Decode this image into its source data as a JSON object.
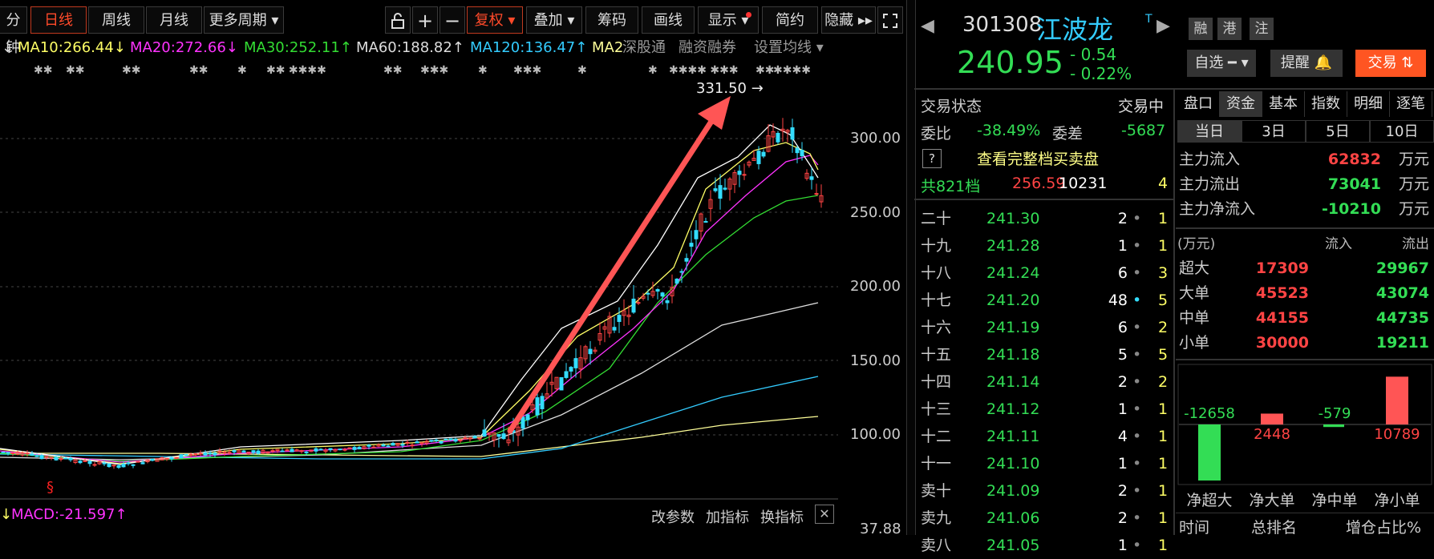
{
  "toolbar": {
    "items": [
      "分钟",
      "日线",
      "周线",
      "月线",
      "更多周期 ▾"
    ],
    "icons": [
      "lock-icon",
      "plus-icon",
      "minus-icon"
    ],
    "fuquan": "复权 ▾",
    "diejia": "叠加 ▾",
    "chouma": "筹码",
    "huaxian": "画线",
    "xianshi": "显示 ▾",
    "jianjie": "简约",
    "yincang": "隐藏 ▸▸"
  },
  "ma_legend": [
    {
      "text": "MA10:266.44",
      "arrow": "↓",
      "color": "#ffff66"
    },
    {
      "text": "MA20:272.66",
      "arrow": "↓",
      "color": "#ff33ff"
    },
    {
      "text": "MA30:252.11",
      "arrow": "↑",
      "color": "#33dd33"
    },
    {
      "text": "MA60:188.82",
      "arrow": "↑",
      "color": "#dddddd"
    },
    {
      "text": "MA120:136.47",
      "arrow": "↑",
      "color": "#33ccff"
    },
    {
      "text": "MA2",
      "arrow": "",
      "color": "#ffff99"
    }
  ],
  "ma_links": [
    "深股通",
    "融资融券",
    "设置均线 ▾"
  ],
  "peak_label": "331.50",
  "y_axis": [
    "300.00",
    "250.00",
    "200.00",
    "150.00",
    "100.00"
  ],
  "y_bottom": "37.88",
  "macd": {
    "text": "MACD:-21.597",
    "arrow": "↑"
  },
  "macd_actions": [
    "改参数",
    "加指标",
    "换指标"
  ],
  "dividend_marker": "§",
  "stock": {
    "code": "301308",
    "name": "江波龙",
    "tag": "T",
    "price": "240.95",
    "change": "- 0.54",
    "change_pct": "- 0.22%",
    "badges": [
      "融",
      "港",
      "注"
    ],
    "watch": "自选 ━ ▾",
    "remind": "提醒 🔔",
    "trade": "交易 ⇅"
  },
  "status": {
    "label": "交易状态",
    "value": "交易中",
    "weibi_label": "委比",
    "weibi": "-38.49%",
    "weicha_label": "委差",
    "weicha": "-5687",
    "full_depth": "查看完整档买卖盘",
    "total_label": "共821档",
    "total_price": "256.59",
    "total_vol": "10231",
    "total_n": "4"
  },
  "orders": [
    {
      "lvl": "二十",
      "price": "241.30",
      "vol": "2",
      "n": "1"
    },
    {
      "lvl": "十九",
      "price": "241.28",
      "vol": "1",
      "n": "1"
    },
    {
      "lvl": "十八",
      "price": "241.24",
      "vol": "6",
      "n": "3"
    },
    {
      "lvl": "十七",
      "price": "241.20",
      "vol": "48",
      "n": "5"
    },
    {
      "lvl": "十六",
      "price": "241.19",
      "vol": "6",
      "n": "2"
    },
    {
      "lvl": "十五",
      "price": "241.18",
      "vol": "5",
      "n": "5"
    },
    {
      "lvl": "十四",
      "price": "241.14",
      "vol": "2",
      "n": "2"
    },
    {
      "lvl": "十三",
      "price": "241.12",
      "vol": "1",
      "n": "1"
    },
    {
      "lvl": "十二",
      "price": "241.11",
      "vol": "4",
      "n": "1"
    },
    {
      "lvl": "十一",
      "price": "241.10",
      "vol": "1",
      "n": "1"
    },
    {
      "lvl": "卖十",
      "price": "241.09",
      "vol": "2",
      "n": "1"
    },
    {
      "lvl": "卖九",
      "price": "241.06",
      "vol": "2",
      "n": "1"
    },
    {
      "lvl": "卖八",
      "price": "241.05",
      "vol": "1",
      "n": "1"
    }
  ],
  "panel_tabs": [
    "盘口",
    "资金",
    "基本",
    "指数",
    "明细",
    "逐笔"
  ],
  "period_tabs": [
    "当日",
    "3日",
    "5日",
    "10日"
  ],
  "fund_flow": [
    {
      "label": "主力流入",
      "value": "62832",
      "unit": "万元",
      "color": "#ff4444"
    },
    {
      "label": "主力流出",
      "value": "73041",
      "unit": "万元",
      "color": "#33dd55"
    },
    {
      "label": "主力净流入",
      "value": "-10210",
      "unit": "万元",
      "color": "#33dd55"
    }
  ],
  "flow_header": {
    "unit": "(万元)",
    "in": "流入",
    "out": "流出"
  },
  "flow_rows": [
    {
      "label": "超大",
      "in": "17309",
      "out": "29967"
    },
    {
      "label": "大单",
      "in": "45523",
      "out": "43074"
    },
    {
      "label": "中单",
      "in": "44155",
      "out": "44735"
    },
    {
      "label": "小单",
      "in": "30000",
      "out": "19211"
    }
  ],
  "net_bars": [
    {
      "label": "净超大",
      "value": "-12658",
      "num": -12658
    },
    {
      "label": "净大单",
      "value": "2448",
      "num": 2448
    },
    {
      "label": "净中单",
      "value": "-579",
      "num": -579
    },
    {
      "label": "净小单",
      "value": "10789",
      "num": 10789
    }
  ],
  "bottom_header": [
    "时间",
    "总排名",
    "增仓占比%"
  ],
  "colors": {
    "up": "#ff4444",
    "down": "#33dd55",
    "accent": "#ff5522",
    "cyan": "#33ddff"
  }
}
